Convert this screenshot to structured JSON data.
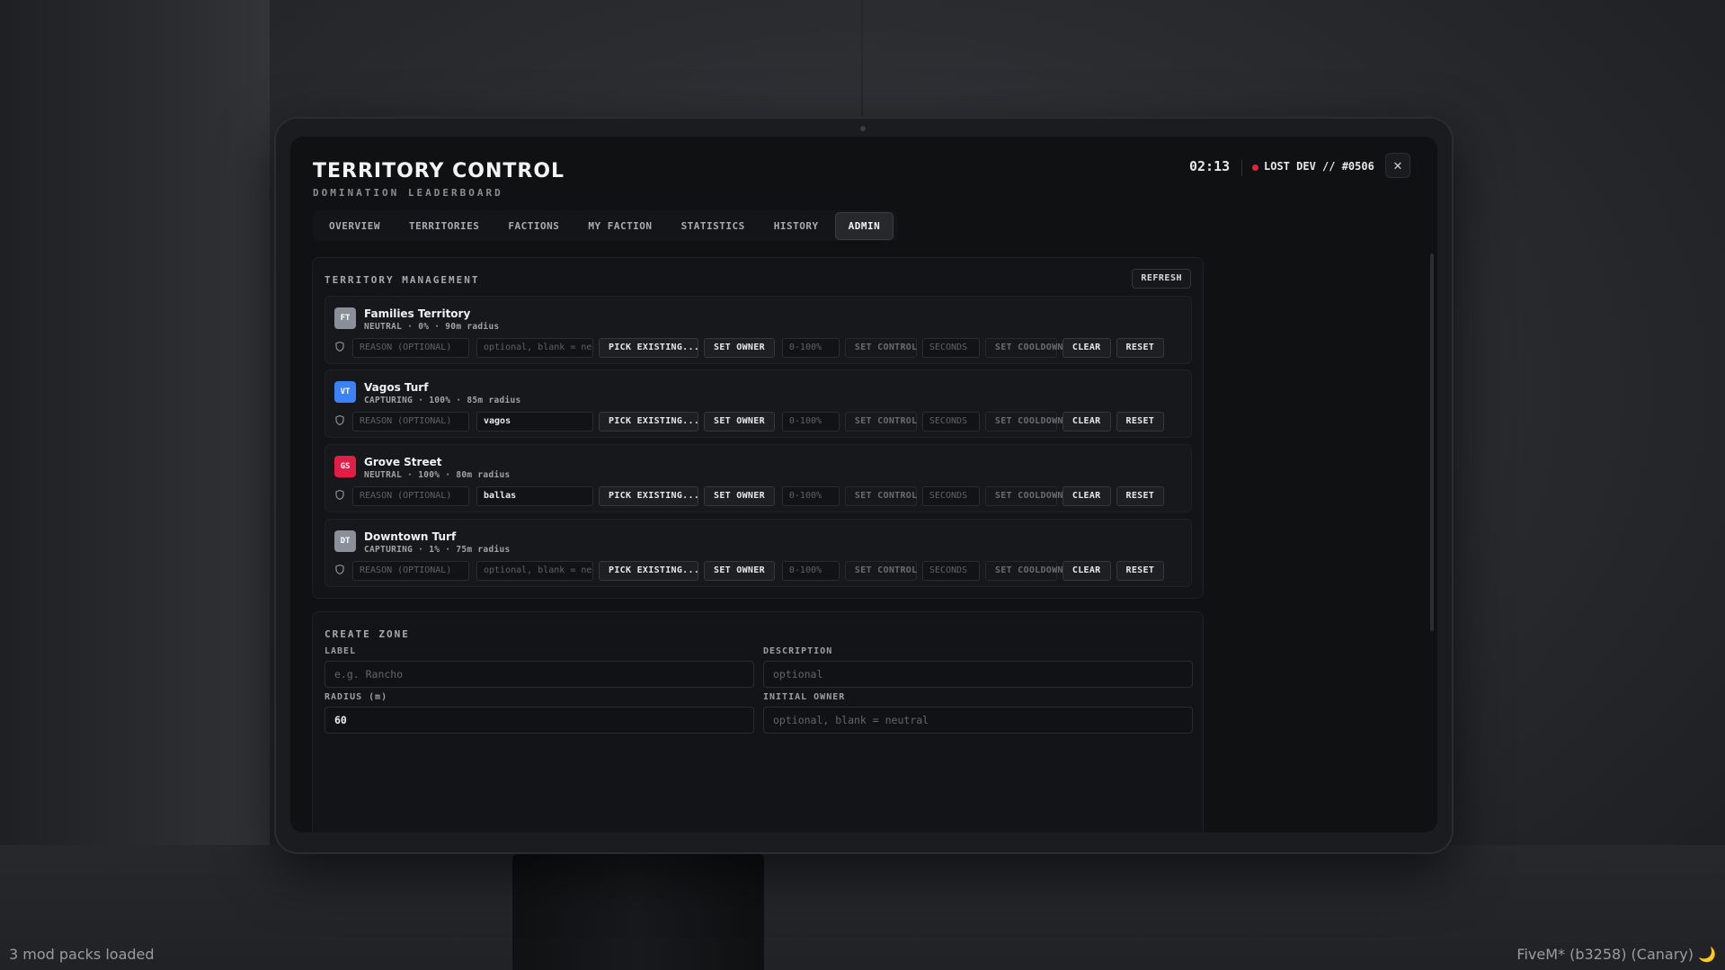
{
  "background": {
    "status_left": "3 mod packs loaded",
    "status_right": "FiveM* (b3258) (Canary) 🌙"
  },
  "header": {
    "title": "TERRITORY CONTROL",
    "subtitle": "DOMINATION LEADERBOARD",
    "clock": "02:13",
    "user": "LOST DEV // #0506",
    "close_icon": "✕"
  },
  "tabs": [
    {
      "label": "OVERVIEW",
      "active": false
    },
    {
      "label": "TERRITORIES",
      "active": false
    },
    {
      "label": "FACTIONS",
      "active": false
    },
    {
      "label": "MY FACTION",
      "active": false
    },
    {
      "label": "STATISTICS",
      "active": false
    },
    {
      "label": "HISTORY",
      "active": false
    },
    {
      "label": "ADMIN",
      "active": true
    }
  ],
  "management": {
    "title": "TERRITORY MANAGEMENT",
    "refresh_label": "REFRESH",
    "controls": {
      "reason_placeholder": "REASON (OPTIONAL)",
      "owner_placeholder": "optional, blank = neutral",
      "pick_label": "PICK EXISTING... ▾",
      "set_owner_label": "SET OWNER",
      "control_placeholder": "0-100%",
      "set_control_label": "SET CONTROL",
      "seconds_placeholder": "SECONDS",
      "set_cooldown_label": "SET COOLDOWN",
      "clear_label": "CLEAR",
      "reset_label": "RESET"
    },
    "territories": [
      {
        "initials": "FT",
        "color": "#8b8f99",
        "name": "Families Territory",
        "meta": "NEUTRAL · 0% · 90m radius",
        "owner_value": ""
      },
      {
        "initials": "VT",
        "color": "#3b82f6",
        "name": "Vagos Turf",
        "meta": "CAPTURING · 100% · 85m radius",
        "owner_value": "vagos"
      },
      {
        "initials": "GS",
        "color": "#e11d48",
        "name": "Grove Street",
        "meta": "NEUTRAL · 100% · 80m radius",
        "owner_value": "ballas"
      },
      {
        "initials": "DT",
        "color": "#8b8f99",
        "name": "Downtown Turf",
        "meta": "CAPTURING · 1% · 75m radius",
        "owner_value": ""
      }
    ]
  },
  "create_zone": {
    "title": "CREATE ZONE",
    "label_label": "LABEL",
    "label_placeholder": "e.g. Rancho",
    "description_label": "DESCRIPTION",
    "description_placeholder": "optional",
    "radius_label": "RADIUS (m)",
    "radius_value": "60",
    "initial_owner_label": "INITIAL OWNER",
    "initial_owner_placeholder": "optional, blank = neutral"
  }
}
